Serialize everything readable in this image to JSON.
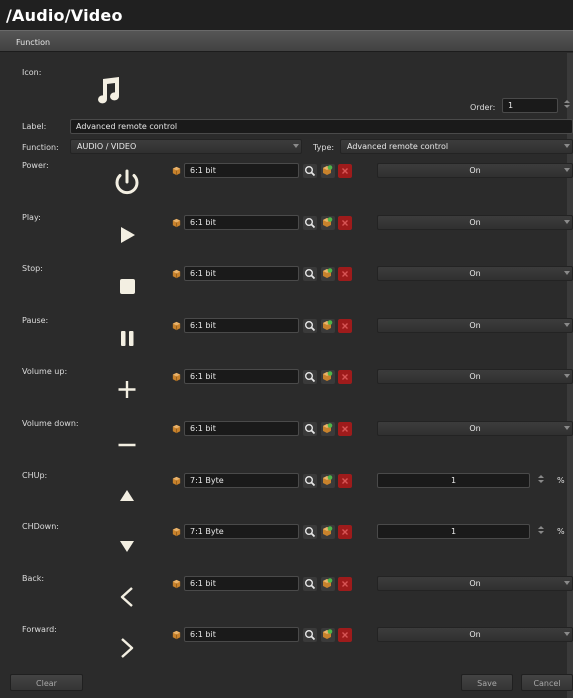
{
  "header": {
    "title": "/Audio/Video"
  },
  "section": {
    "label": "Function"
  },
  "form": {
    "icon_label": "Icon:",
    "order_label": "Order:",
    "order_value": "1",
    "label_label": "Label:",
    "label_value": "Advanced remote control",
    "function_label": "Function:",
    "function_value": "AUDIO / VIDEO",
    "type_label": "Type:",
    "type_value": "Advanced remote control"
  },
  "rows": [
    {
      "label": "Power:",
      "icon": "power-icon",
      "object": "6:1 bit",
      "value": "On",
      "control": "select"
    },
    {
      "label": "Play:",
      "icon": "play-icon",
      "object": "6:1 bit",
      "value": "On",
      "control": "select"
    },
    {
      "label": "Stop:",
      "icon": "stop-icon",
      "object": "6:1 bit",
      "value": "On",
      "control": "select"
    },
    {
      "label": "Pause:",
      "icon": "pause-icon",
      "object": "6:1 bit",
      "value": "On",
      "control": "select"
    },
    {
      "label": "Volume up:",
      "icon": "plus-icon",
      "object": "6:1 bit",
      "value": "On",
      "control": "select"
    },
    {
      "label": "Volume down:",
      "icon": "minus-icon",
      "object": "6:1 bit",
      "value": "On",
      "control": "select"
    },
    {
      "label": "CHUp:",
      "icon": "triangle-up-icon",
      "object": "7:1 Byte",
      "value": "1",
      "control": "number",
      "unit": "%"
    },
    {
      "label": "CHDown:",
      "icon": "triangle-down-icon",
      "object": "7:1 Byte",
      "value": "1",
      "control": "number",
      "unit": "%"
    },
    {
      "label": "Back:",
      "icon": "chevron-left-icon",
      "object": "6:1 bit",
      "value": "On",
      "control": "select"
    },
    {
      "label": "Forward:",
      "icon": "chevron-right-icon",
      "object": "6:1 bit",
      "value": "On",
      "control": "select"
    }
  ],
  "footer": {
    "clear_label": "Clear",
    "save_label": "Save",
    "cancel_label": "Cancel"
  },
  "colors": {
    "background": "#2b2b2b",
    "field": "#1a1a1a",
    "remove": "#9e1b1b",
    "icon": "#f3efe2"
  }
}
